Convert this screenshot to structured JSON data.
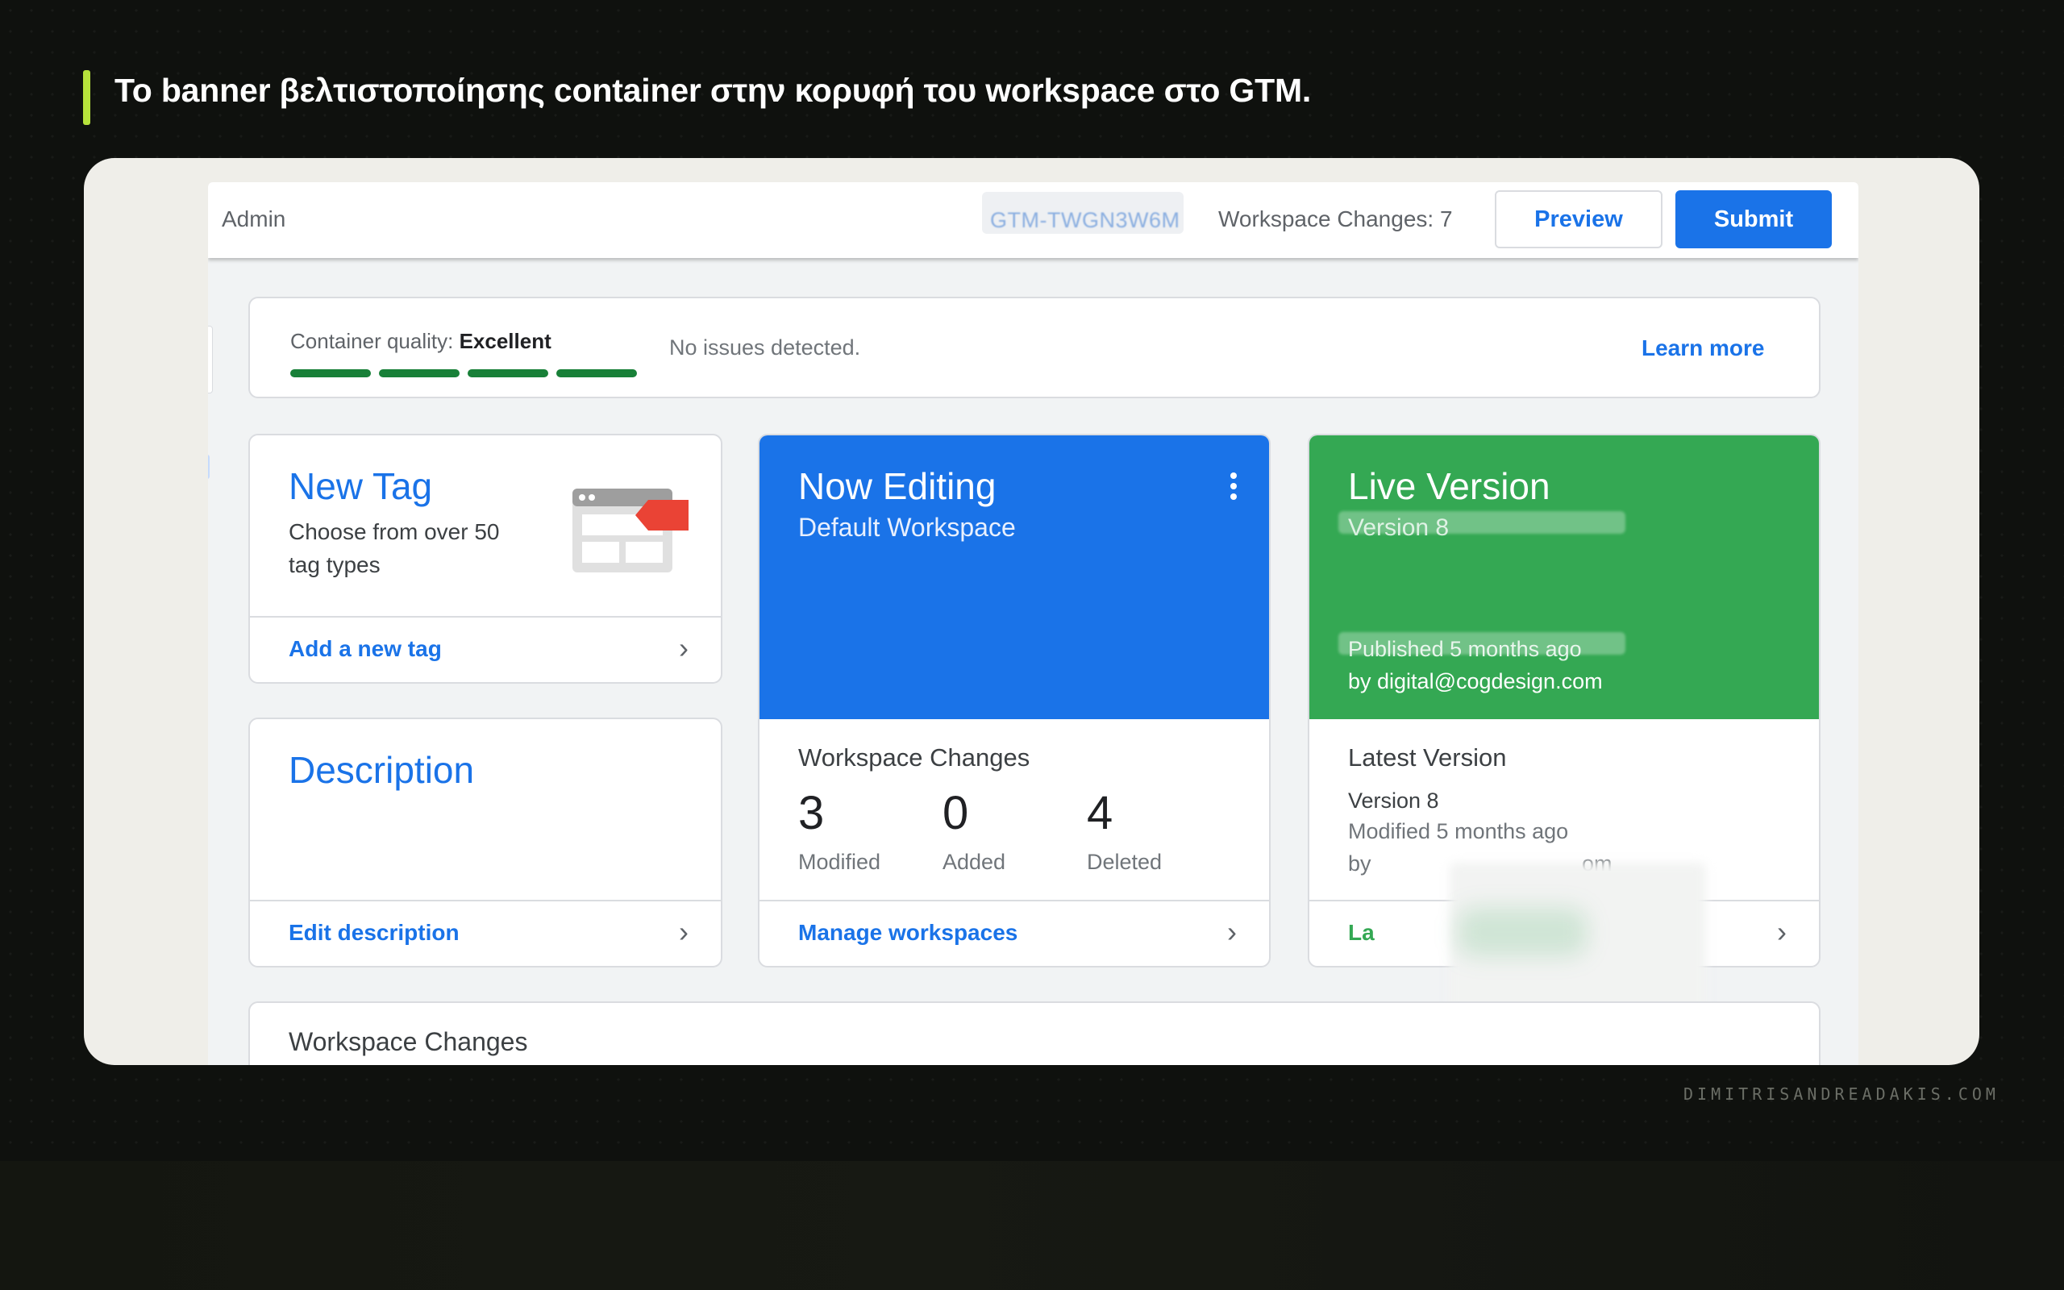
{
  "headline": "Το banner βελτιστοποίησης container στην κορυφή του workspace στο GTM.",
  "watermark": "DIMITRISANDREADAKIS.COM",
  "colors": {
    "accent": "#b6e23b",
    "gtm_blue": "#1a73e8",
    "gtm_green": "#34a853",
    "quality_green": "#188038"
  },
  "gtm": {
    "topbar": {
      "admin_label": "Admin",
      "container_id": "GTM-TWGN3W6M",
      "workspace_changes": "Workspace Changes: 7",
      "preview_label": "Preview",
      "submit_label": "Submit"
    },
    "quality": {
      "label": "Container quality:",
      "value": "Excellent",
      "bars_filled": 4,
      "issues_text": "No issues detected.",
      "learn_more": "Learn more"
    },
    "new_tag": {
      "title": "New Tag",
      "subtitle": "Choose from over 50 tag types",
      "link": "Add a new tag",
      "icon": "tag-template-icon"
    },
    "description": {
      "title": "Description",
      "link": "Edit description"
    },
    "now_editing": {
      "title": "Now Editing",
      "workspace": "Default Workspace",
      "changes_title": "Workspace Changes",
      "stats": [
        {
          "value": "3",
          "label": "Modified"
        },
        {
          "value": "0",
          "label": "Added"
        },
        {
          "value": "4",
          "label": "Deleted"
        }
      ],
      "link": "Manage workspaces"
    },
    "live_version": {
      "title": "Live Version",
      "version": "Version 8",
      "published": "Published 5 months ago",
      "by": "by digital@cogdesign.com",
      "latest_title": "Latest Version",
      "latest_version": "Version 8",
      "modified": "Modified 5 months ago",
      "by_partial_start": "by",
      "by_partial_end": "om",
      "link_partial": "La"
    },
    "bottom_panel_title": "Workspace Changes"
  }
}
